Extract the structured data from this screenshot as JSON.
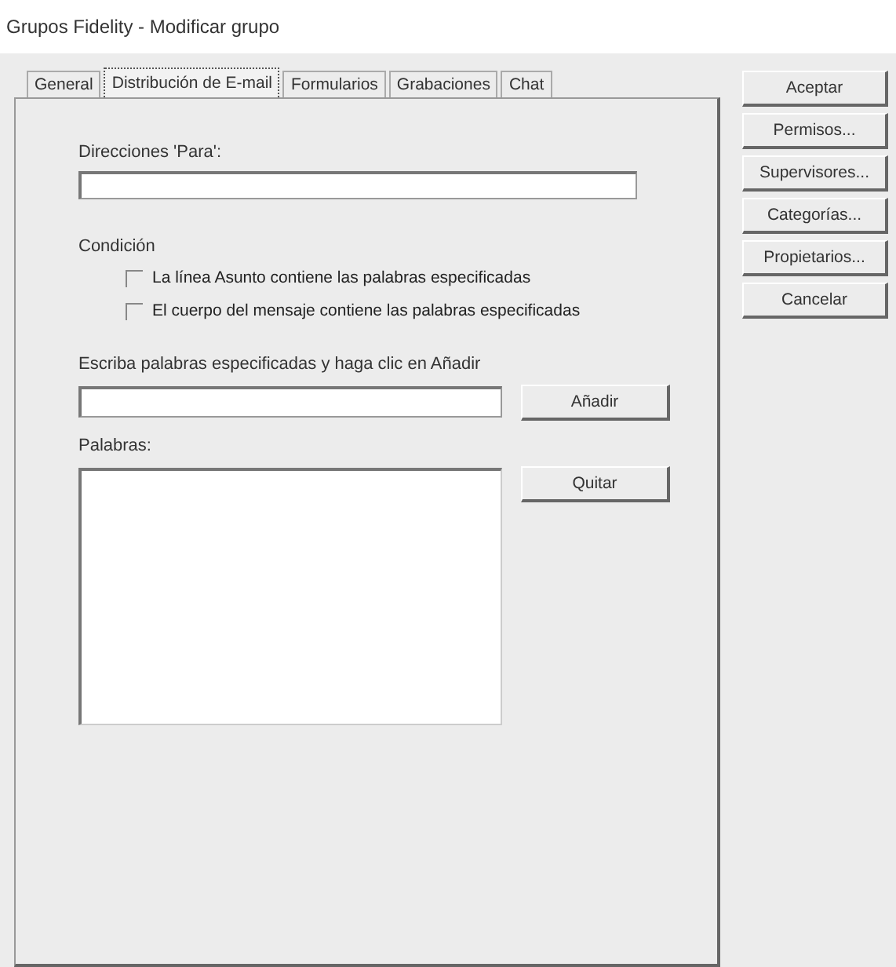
{
  "window": {
    "title": "Grupos Fidelity - Modificar grupo"
  },
  "tabs": [
    {
      "label": "General",
      "selected": false
    },
    {
      "label": "Distribución de E-mail",
      "selected": true
    },
    {
      "label": "Formularios",
      "selected": false
    },
    {
      "label": "Grabaciones",
      "selected": false
    },
    {
      "label": "Chat",
      "selected": false
    }
  ],
  "to_addresses": {
    "label": "Direcciones 'Para':"
  },
  "condition": {
    "label": "Condición",
    "options": [
      {
        "label": "La línea Asunto contiene las palabras especificadas",
        "checked": false
      },
      {
        "label": "El cuerpo del mensaje contiene las palabras especificadas",
        "checked": false
      }
    ]
  },
  "word_entry": {
    "label": "Escriba palabras especificadas y haga clic en Añadir",
    "button": "Añadir"
  },
  "words": {
    "label": "Palabras:",
    "button": "Quitar"
  },
  "buttons": [
    "Aceptar",
    "Permisos...",
    "Supervisores...",
    "Categorías...",
    "Propietarios...",
    "Cancelar"
  ]
}
